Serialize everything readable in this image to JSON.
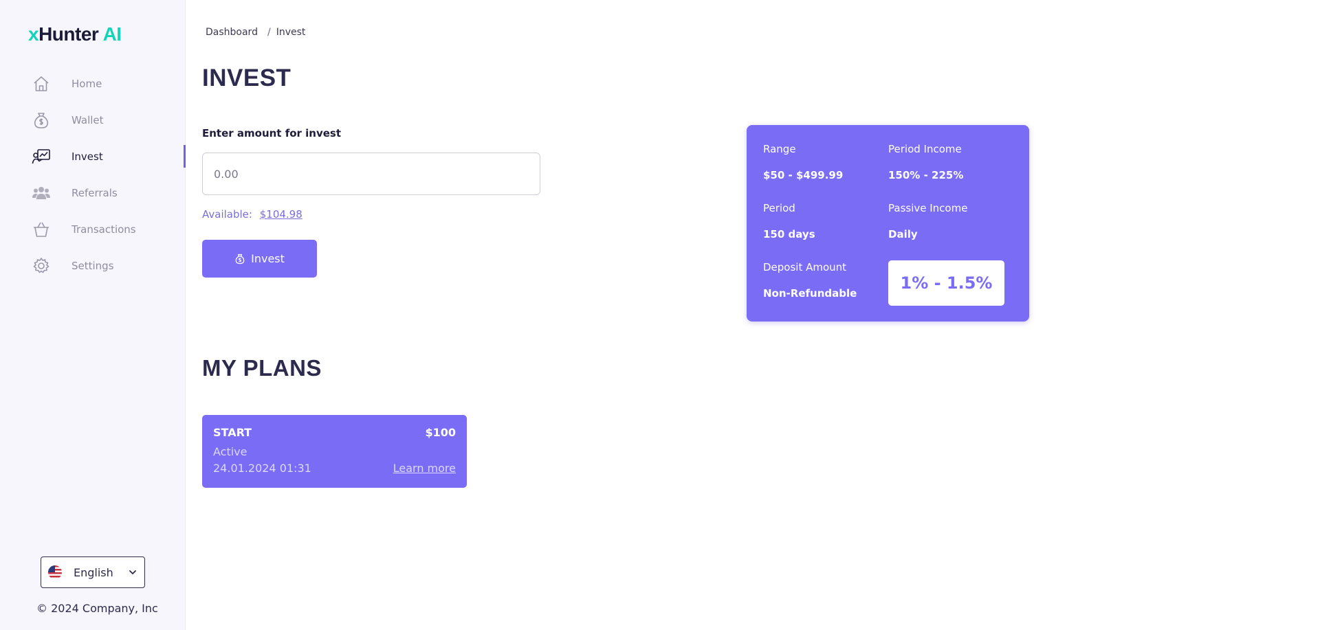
{
  "brand": {
    "x": "x",
    "name": "Hunter",
    "ai": "AI"
  },
  "sidebar": {
    "items": [
      {
        "label": "Home",
        "icon": "home-icon"
      },
      {
        "label": "Wallet",
        "icon": "money-bag-icon"
      },
      {
        "label": "Invest",
        "icon": "invest-chart-icon",
        "active": true
      },
      {
        "label": "Referrals",
        "icon": "users-icon"
      },
      {
        "label": "Transactions",
        "icon": "basket-icon"
      },
      {
        "label": "Settings",
        "icon": "gear-icon"
      }
    ],
    "language": {
      "label": "English",
      "icon": "us-flag-icon"
    },
    "copyright": "© 2024 Company, Inc"
  },
  "breadcrumb": {
    "root": "Dashboard",
    "sep": "/",
    "current": "Invest"
  },
  "invest": {
    "title": "INVEST",
    "field_label": "Enter amount for invest",
    "placeholder": "0.00",
    "available_label": "Available:",
    "available_amount": "$104.98",
    "button_label": "Invest"
  },
  "plan_info": {
    "range_label": "Range",
    "range_value": "$50 - $499.99",
    "period_income_label": "Period Income",
    "period_income_value": "150% - 225%",
    "period_label": "Period",
    "period_value": "150 days",
    "passive_income_label": "Passive Income",
    "passive_income_value": "Daily",
    "deposit_label": "Deposit Amount",
    "deposit_value": "Non-Refundable",
    "rate": "1% - 1.5%"
  },
  "my_plans": {
    "title": "MY PLANS",
    "plans": [
      {
        "name": "START",
        "amount": "$100",
        "status": "Active",
        "date": "24.01.2024 01:31",
        "link": "Learn more"
      }
    ]
  },
  "colors": {
    "accent": "#7b6cf6",
    "brand": "#12d4b8",
    "sidebar_bg": "#f7f6fd"
  }
}
